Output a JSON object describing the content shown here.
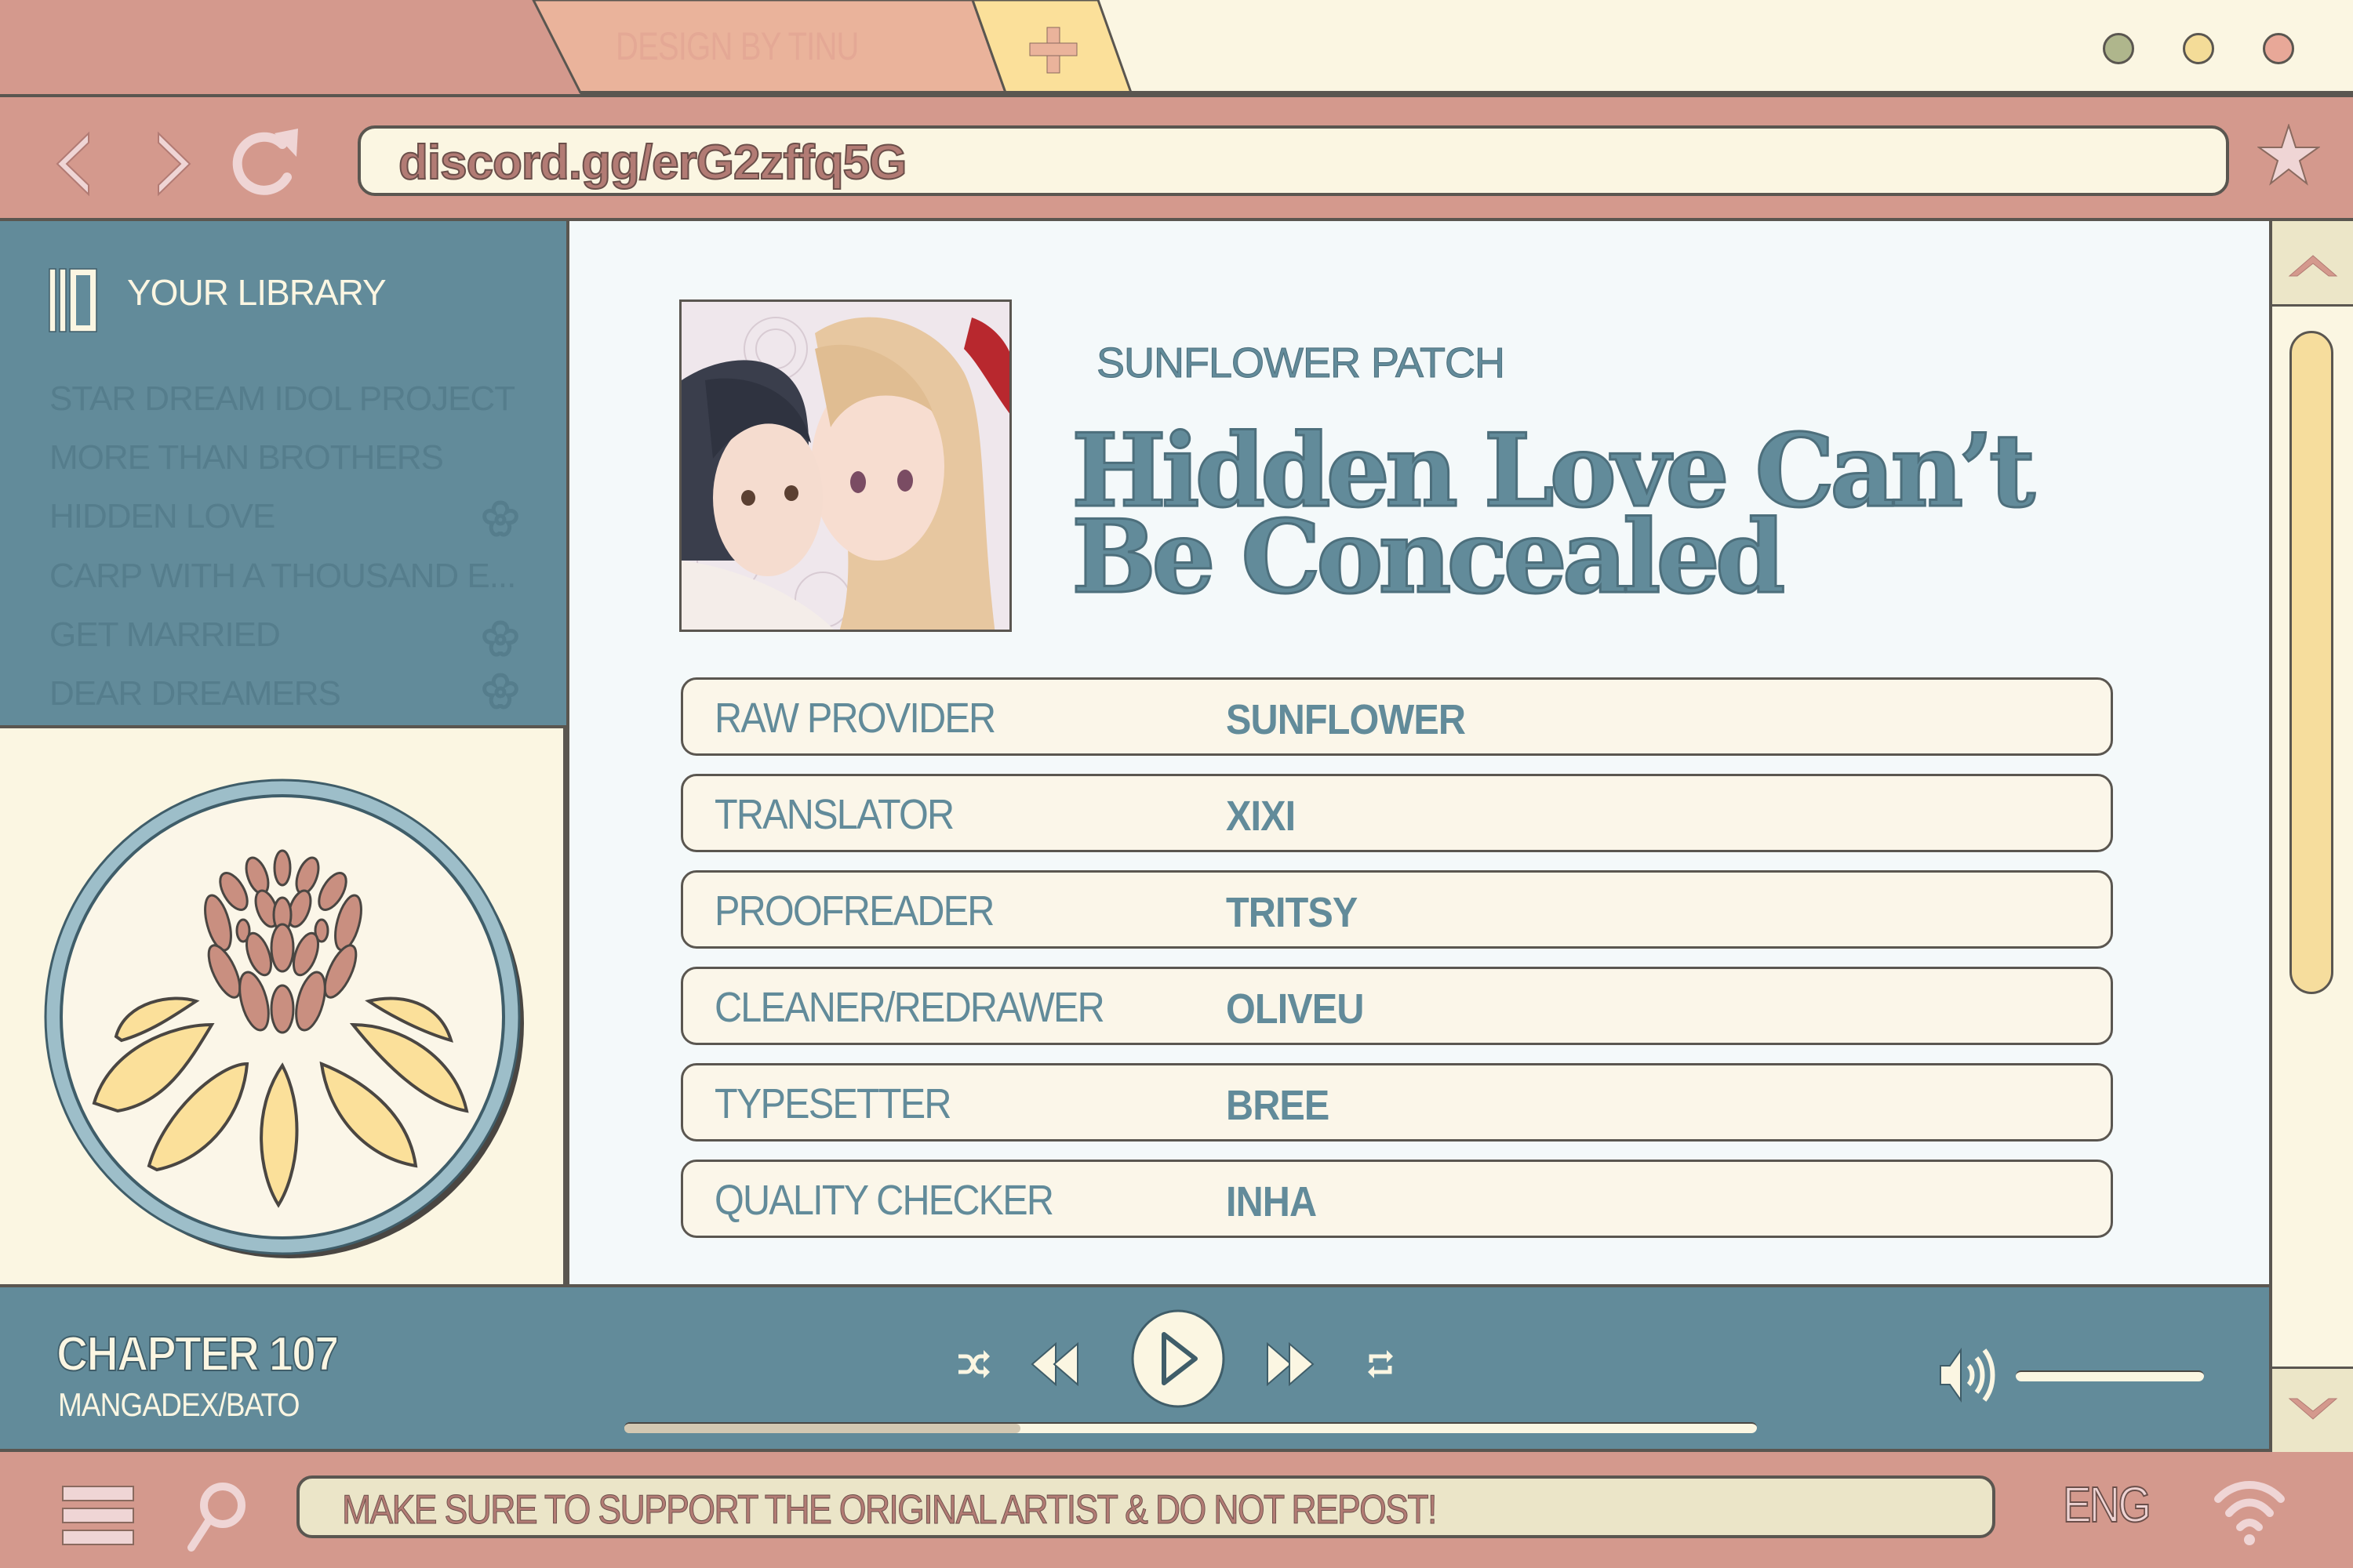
{
  "browser": {
    "tab_label": "DESIGN BY TINU",
    "new_tab_icon": "plus-icon",
    "window_dots": [
      {
        "name": "minimize",
        "color": "#afb68c"
      },
      {
        "name": "maximize",
        "color": "#f4dc98"
      },
      {
        "name": "close",
        "color": "#e8a898"
      }
    ],
    "nav": {
      "back_icon": "chevron-left-icon",
      "forward_icon": "chevron-right-icon",
      "reload_icon": "reload-icon"
    },
    "address": "discord.gg/erG2zffq5G",
    "bookmark_icon": "star-icon"
  },
  "sidebar": {
    "title": "YOUR LIBRARY",
    "icon": "library-icon",
    "items": [
      {
        "label": "STAR DREAM IDOL PROJECT",
        "flower": false
      },
      {
        "label": "MORE THAN BROTHERS",
        "flower": false
      },
      {
        "label": "HIDDEN LOVE",
        "flower": true
      },
      {
        "label": "CARP WITH A THOUSAND E...",
        "flower": false
      },
      {
        "label": "GET MARRIED",
        "flower": true
      },
      {
        "label": "DEAR DREAMERS",
        "flower": true
      }
    ],
    "logo": "sunflower-logo"
  },
  "main": {
    "group": "SUNFLOWER PATCH",
    "title_line1": "Hidden Love Can’t",
    "title_line2": "Be Concealed",
    "credits": [
      {
        "role": "RAW PROVIDER",
        "name": "SUNFLOWER"
      },
      {
        "role": "TRANSLATOR",
        "name": "XIXI"
      },
      {
        "role": "PROOFREADER",
        "name": "TRITSY"
      },
      {
        "role": "CLEANER/REDRAWER",
        "name": "OLIVEU"
      },
      {
        "role": "TYPESETTER",
        "name": "BREE"
      },
      {
        "role": "QUALITY CHECKER",
        "name": "INHA"
      }
    ]
  },
  "player": {
    "chapter": "CHAPTER 107",
    "source": "MANGADEX/BATO",
    "progress_fraction": 0.35,
    "volume_fraction": 1.0,
    "controls": [
      "shuffle-icon",
      "rewind-icon",
      "play-icon",
      "fast-forward-icon",
      "repeat-icon"
    ],
    "volume_icon": "volume-icon"
  },
  "statusbar": {
    "menu_icon": "menu-icon",
    "search_icon": "search-icon",
    "notice": "MAKE SURE TO SUPPORT THE ORIGINAL ARTIST & DO NOT REPOST!",
    "language": "ENG",
    "wifi_icon": "wifi-icon"
  },
  "colors": {
    "pink": "#d4998d",
    "cream": "#fbf6e2",
    "teal": "#628b9a",
    "yellow": "#f6dd9d",
    "outline": "#5a5650"
  }
}
